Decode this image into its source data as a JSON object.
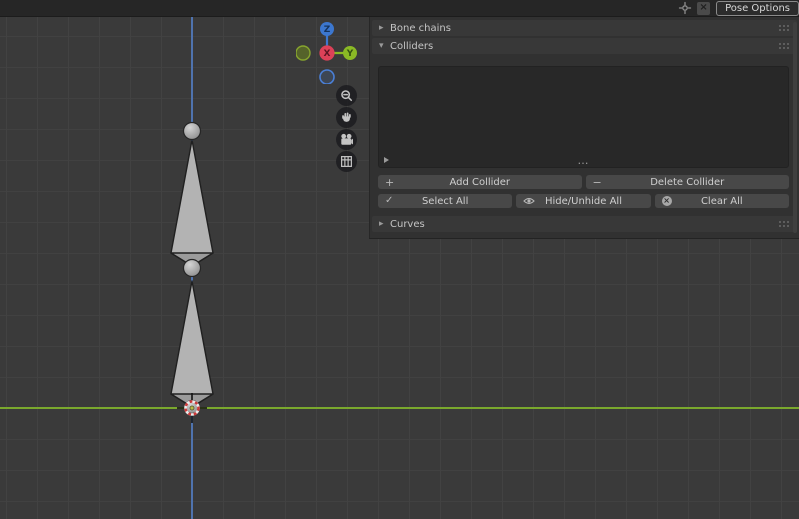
{
  "topbar": {
    "tab_label": "Pose Options",
    "close_glyph": "×"
  },
  "panel": {
    "sections": {
      "bone_chains": {
        "label": "Bone chains",
        "collapsed": true
      },
      "colliders": {
        "label": "Colliders",
        "collapsed": false
      },
      "curves": {
        "label": "Curves",
        "collapsed": true
      }
    },
    "icons": {
      "collapsed_arrow": "▸",
      "expanded_arrow": "▾",
      "plus": "+",
      "minus": "−",
      "check": "✓",
      "clear_x": "×"
    },
    "list": {
      "items": [],
      "overflow_dots": "…"
    },
    "buttons": {
      "add_collider": "Add Collider",
      "delete_collider": "Delete Collider",
      "select_all": "Select All",
      "hide_unhide_all": "Hide/Unhide All",
      "clear_all": "Clear All"
    }
  },
  "viewport": {
    "gizmo": {
      "x": "X",
      "y": "Y",
      "z": "Z"
    },
    "colors": {
      "axis_y_green": "#7aa82d",
      "axis_z_blue": "#4f73ae",
      "gizmo_x_red": "#dd4158",
      "gizmo_y_green": "#8ab925",
      "gizmo_z_blue": "#3c77cf",
      "bone_gray": "#b3b3b3",
      "cursor_red": "#cc3a3a"
    }
  }
}
